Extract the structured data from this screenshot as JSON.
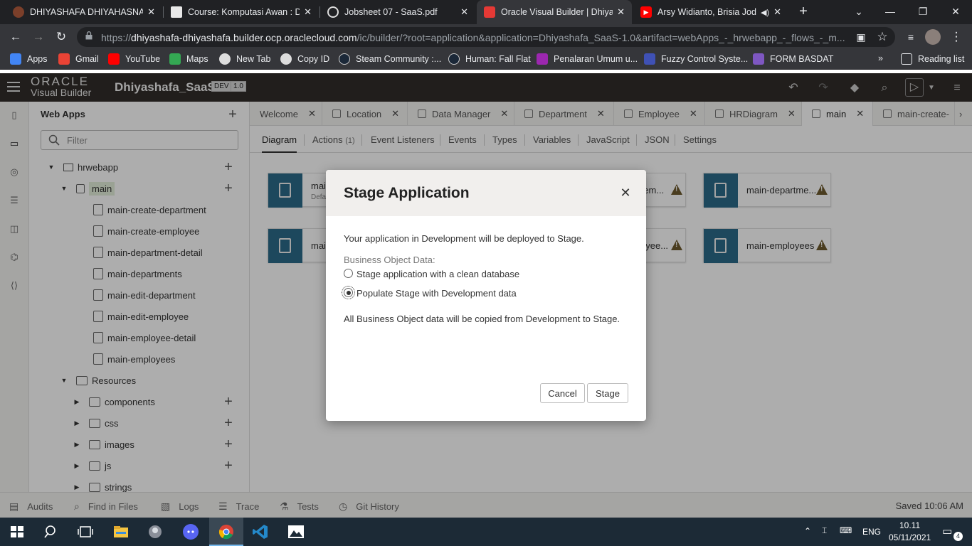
{
  "browser": {
    "tabs": [
      {
        "title": "DHIYASHAFA DHIYAHASNA H",
        "icon": "crest-icon",
        "color": "#7b3f2a"
      },
      {
        "title": "Course: Komputasi Awan : Dip",
        "icon": "moodle-icon",
        "color": "#e8e8e8"
      },
      {
        "title": "Jobsheet 07 - SaaS.pdf",
        "icon": "globe-icon",
        "color": "#dddddd"
      },
      {
        "title": "Oracle Visual Builder | Dhiyas",
        "icon": "oracle-icon",
        "color": "#e53935"
      },
      {
        "title": "Arsy Widianto, Brisia Jodi",
        "icon": "youtube-icon",
        "color": "#ff0000"
      }
    ],
    "url_prefix": "https://",
    "url_host": "dhiyashafa-dhiyashafa.builder.ocp.oraclecloud.com",
    "url_rest": "/ic/builder/?root=application&application=Dhiyashafa_SaaS-1.0&artifact=webApps_-_hrwebapp_-_flows_-_m...",
    "bookmarks": [
      {
        "label": "Apps",
        "color": "#4285f4"
      },
      {
        "label": "Gmail",
        "color": "#ea4335"
      },
      {
        "label": "YouTube",
        "color": "#ff0000"
      },
      {
        "label": "Maps",
        "color": "#34a853"
      },
      {
        "label": "New Tab",
        "color": "#dddddd"
      },
      {
        "label": "Copy ID",
        "color": "#dddddd"
      },
      {
        "label": "Steam Community :...",
        "color": "#1b2838"
      },
      {
        "label": "Human: Fall Flat",
        "color": "#1b2838"
      },
      {
        "label": "Penalaran Umum u...",
        "color": "#9c27b0"
      },
      {
        "label": "Fuzzy Control Syste...",
        "color": "#3f51b5"
      },
      {
        "label": "FORM BASDAT",
        "color": "#7e57c2"
      }
    ],
    "reading_list": "Reading list"
  },
  "header": {
    "logo_top": "ORACLE",
    "logo_bottom": "Visual Builder",
    "app_name": "Dhiyashafa_SaaS",
    "badge_env": "DEV",
    "badge_version": "1.0"
  },
  "navigator": {
    "title": "Web Apps",
    "filter_placeholder": "Filter",
    "tree": {
      "app": "hrwebapp",
      "flow": "main",
      "pages": [
        "main-create-department",
        "main-create-employee",
        "main-department-detail",
        "main-departments",
        "main-edit-department",
        "main-edit-employee",
        "main-employee-detail",
        "main-employees"
      ],
      "resources": "Resources",
      "folders": [
        "components",
        "css",
        "images",
        "js",
        "strings"
      ]
    }
  },
  "editor_tabs": [
    "Welcome",
    "Location",
    "Data Manager",
    "Department",
    "Employee",
    "HRDiagram",
    "main",
    "main-create-"
  ],
  "sub_tabs": {
    "diagram": "Diagram",
    "actions": "Actions",
    "actions_count": "(1)",
    "event_listeners": "Event Listeners",
    "events": "Events",
    "types": "Types",
    "variables": "Variables",
    "javascript": "JavaScript",
    "json": "JSON",
    "settings": "Settings"
  },
  "canvas_cards": {
    "c1_name": "mai",
    "c1_sub": "Defa",
    "c2_name": "mai",
    "c3_name": "-em...",
    "c4_name": "main-departme...",
    "c5_name": "oyee...",
    "c6_name": "main-employees"
  },
  "dialog": {
    "title": "Stage Application",
    "intro": "Your application in Development will be deployed to Stage.",
    "bo_label": "Business Object Data:",
    "option_clean": "Stage application with a clean database",
    "option_populate": "Populate Stage with Development data",
    "selected": "populate",
    "note": "All Business Object data will be copied from Development to Stage.",
    "cancel": "Cancel",
    "stage": "Stage"
  },
  "statusbar": {
    "audits": "Audits",
    "find": "Find in Files",
    "logs": "Logs",
    "trace": "Trace",
    "tests": "Tests",
    "git": "Git History",
    "saved": "Saved 10:06 AM"
  },
  "taskbar": {
    "lang": "ENG",
    "time": "10.11",
    "date": "05/11/2021",
    "notif_count": "4"
  }
}
